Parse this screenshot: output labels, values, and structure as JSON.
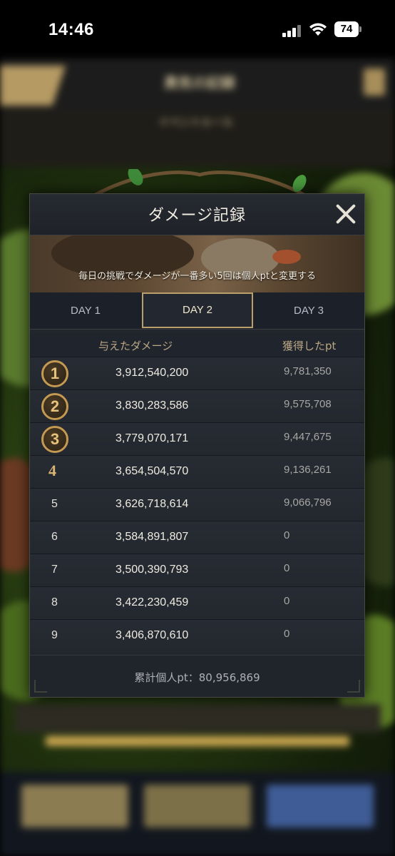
{
  "status_bar": {
    "time": "14:46",
    "battery": "74"
  },
  "background_app": {
    "title": "勇気の記録",
    "subtitle": "イベントルール"
  },
  "modal": {
    "title": "ダメージ記録",
    "banner_text": "毎日の挑戦でダメージが一番多い5回は個人ptと変更する",
    "tabs": [
      {
        "label": "DAY 1",
        "active": false
      },
      {
        "label": "DAY 2",
        "active": true
      },
      {
        "label": "DAY 3",
        "active": false
      }
    ],
    "columns": {
      "damage": "与えたダメージ",
      "points": "獲得したpt"
    },
    "rows": [
      {
        "rank": "1",
        "damage": "3,912,540,200",
        "points": "9,781,350"
      },
      {
        "rank": "2",
        "damage": "3,830,283,586",
        "points": "9,575,708"
      },
      {
        "rank": "3",
        "damage": "3,779,070,171",
        "points": "9,447,675"
      },
      {
        "rank": "4",
        "damage": "3,654,504,570",
        "points": "9,136,261"
      },
      {
        "rank": "5",
        "damage": "3,626,718,614",
        "points": "9,066,796"
      },
      {
        "rank": "6",
        "damage": "3,584,891,807",
        "points": "0"
      },
      {
        "rank": "7",
        "damage": "3,500,390,793",
        "points": "0"
      },
      {
        "rank": "8",
        "damage": "3,422,230,459",
        "points": "0"
      },
      {
        "rank": "9",
        "damage": "3,406,870,610",
        "points": "0"
      }
    ],
    "total": "累計個人pt：80,956,869"
  },
  "colors": {
    "accent_gold": "#b9a06a",
    "panel": "#22262d"
  }
}
